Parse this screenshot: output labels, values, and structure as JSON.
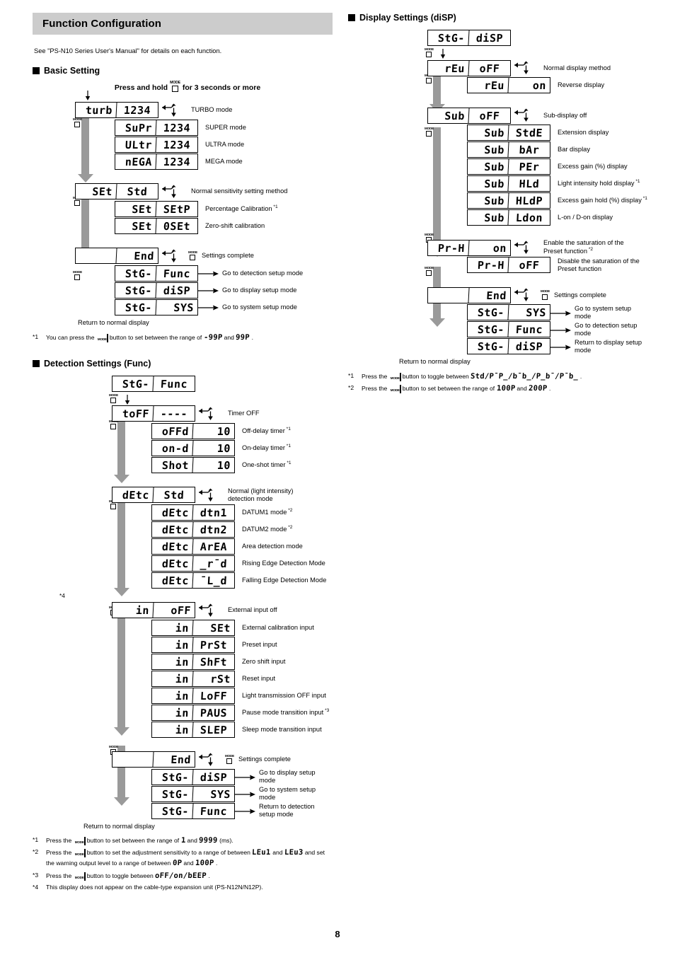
{
  "header": {
    "title": "Function Configuration"
  },
  "intro": "See \"PS-N10 Series User's Manual\" for details on each function.",
  "page_number": "8",
  "mode_label": "MODE",
  "basic": {
    "heading": "Basic Setting",
    "press_hold_pre": "Press and hold",
    "press_hold_post": "for 3 seconds or more",
    "return_text": "Return to normal display",
    "rows": [
      {
        "main": "turb",
        "val": "1234",
        "cap": "TURBO mode"
      },
      {
        "main": "SuPr",
        "val": "1234",
        "cap": "SUPER mode"
      },
      {
        "main": "ULtr",
        "val": "1234",
        "cap": "ULTRA mode"
      },
      {
        "main": "nEGA",
        "val": "1234",
        "cap": "MEGA mode"
      },
      {
        "main": "SEt",
        "val": "Std",
        "cap": "Normal sensitivity setting method"
      },
      {
        "main": "SEt",
        "val": "SEtP",
        "cap": "Percentage Calibration",
        "sup": "*1"
      },
      {
        "main": "SEt",
        "val": "0SEt",
        "cap": "Zero-shift calibration"
      },
      {
        "main": "",
        "val": "End",
        "cap": "Settings complete"
      },
      {
        "main": "StG-",
        "val": "Func",
        "cap": "Go to detection setup mode"
      },
      {
        "main": "StG-",
        "val": "diSP",
        "cap": "Go to display setup mode"
      },
      {
        "main": "StG-",
        "val": "SYS",
        "cap": "Go to system setup mode"
      }
    ],
    "footnotes": [
      {
        "mark": "*1",
        "parts": [
          "You can press the",
          "button to set between the range of",
          "-99P",
          "and",
          "99P",
          "."
        ]
      }
    ]
  },
  "detection": {
    "heading": "Detection Settings (Func)",
    "return_text": "Return to normal display",
    "rows": [
      {
        "main": "StG-",
        "val": "Func",
        "cap": ""
      },
      {
        "main": "toFF",
        "val": "----",
        "cap": "Timer OFF"
      },
      {
        "main": "oFFd",
        "val": "10",
        "cap": "Off-delay timer",
        "sup": "*1"
      },
      {
        "main": "on-d",
        "val": "10",
        "cap": "On-delay timer",
        "sup": "*1"
      },
      {
        "main": "Shot",
        "val": "10",
        "cap": "One-shot timer",
        "sup": "*1"
      },
      {
        "main": "dEtc",
        "val": "Std",
        "cap": "Normal (light intensity)\ndetection mode"
      },
      {
        "main": "dEtc",
        "val": "dtn1",
        "cap": "DATUM1 mode",
        "sup": "*2"
      },
      {
        "main": "dEtc",
        "val": "dtn2",
        "cap": "DATUM2 mode",
        "sup": "*2"
      },
      {
        "main": "dEtc",
        "val": "ArEA",
        "cap": "Area detection mode"
      },
      {
        "main": "dEtc",
        "val": "_r¯d",
        "cap": "Rising Edge Detection Mode"
      },
      {
        "main": "dEtc",
        "val": "¯L_d",
        "cap": "Falling Edge Detection Mode"
      },
      {
        "main": "in",
        "val": "oFF",
        "cap": "External input off",
        "lmark": "*4"
      },
      {
        "main": "in",
        "val": "SEt",
        "cap": "External calibration input"
      },
      {
        "main": "in",
        "val": "PrSt",
        "cap": "Preset input"
      },
      {
        "main": "in",
        "val": "ShFt",
        "cap": "Zero shift input"
      },
      {
        "main": "in",
        "val": "rSt",
        "cap": "Reset input"
      },
      {
        "main": "in",
        "val": "LoFF",
        "cap": "Light transmission OFF input"
      },
      {
        "main": "in",
        "val": "PAUS",
        "cap": "Pause mode transition input",
        "sup": "*3"
      },
      {
        "main": "in",
        "val": "SLEP",
        "cap": "Sleep mode transition input"
      },
      {
        "main": "",
        "val": "End",
        "cap": "Settings complete"
      },
      {
        "main": "StG-",
        "val": "diSP",
        "cap": "Go to display setup mode"
      },
      {
        "main": "StG-",
        "val": "SYS",
        "cap": "Go to system setup mode"
      },
      {
        "main": "StG-",
        "val": "Func",
        "cap": "Return to detection\nsetup mode"
      }
    ],
    "footnotes": [
      {
        "mark": "*1",
        "parts": [
          "Press the",
          "button to set between the range of",
          "1",
          "and",
          "9999",
          "(ms)."
        ]
      },
      {
        "mark": "*2",
        "parts": [
          "Press the",
          "button to set the adjustment sensitivity to a range of between",
          "LEu1",
          "and",
          "LEu3",
          "and set the warning output level to a range of between",
          "0P",
          "and",
          "100P",
          "."
        ]
      },
      {
        "mark": "*3",
        "parts": [
          "Press the",
          "button to toggle between",
          "oFF/on/bEEP",
          "."
        ]
      },
      {
        "mark": "*4",
        "parts": [
          "This display does not appear on the cable-type expansion unit (PS-N12N/N12P)."
        ]
      }
    ]
  },
  "display": {
    "heading": "Display Settings (diSP)",
    "return_text": "Return to normal display",
    "rows": [
      {
        "main": "StG-",
        "val": "diSP",
        "cap": ""
      },
      {
        "main": "rEu",
        "val": "oFF",
        "cap": "Normal display method"
      },
      {
        "main": "rEu",
        "val": "on",
        "cap": "Reverse display"
      },
      {
        "main": "Sub",
        "val": "oFF",
        "cap": "Sub-display off"
      },
      {
        "main": "Sub",
        "val": "StdE",
        "cap": "Extension display"
      },
      {
        "main": "Sub",
        "val": "bAr",
        "cap": "Bar display"
      },
      {
        "main": "Sub",
        "val": "PEr",
        "cap": "Excess gain (%) display"
      },
      {
        "main": "Sub",
        "val": "HLd",
        "cap": "Light intensity hold display",
        "sup": "*1"
      },
      {
        "main": "Sub",
        "val": "HLdP",
        "cap": "Excess gain hold (%) display",
        "sup": "*1"
      },
      {
        "main": "Sub",
        "val": "Ldon",
        "cap": "L-on / D-on display"
      },
      {
        "main": "Pr-H",
        "val": "on",
        "cap": "Enable the saturation of the\nPreset function",
        "sup": "*2"
      },
      {
        "main": "Pr-H",
        "val": "oFF",
        "cap": "Disable the saturation of the\nPreset function"
      },
      {
        "main": "",
        "val": "End",
        "cap": "Settings complete"
      },
      {
        "main": "StG-",
        "val": "SYS",
        "cap": "Go to system setup mode"
      },
      {
        "main": "StG-",
        "val": "Func",
        "cap": "Go to detection setup mode"
      },
      {
        "main": "StG-",
        "val": "diSP",
        "cap": "Return to display setup mode"
      }
    ],
    "footnotes": [
      {
        "mark": "*1",
        "parts": [
          "Press the",
          "button to toggle between",
          "Std/P¯P_/b¯b_/P_b¯/P¯b_",
          "."
        ]
      },
      {
        "mark": "*2",
        "parts": [
          "Press the",
          "button to set between the range of",
          "100P",
          "and",
          "200P",
          "."
        ]
      }
    ]
  }
}
